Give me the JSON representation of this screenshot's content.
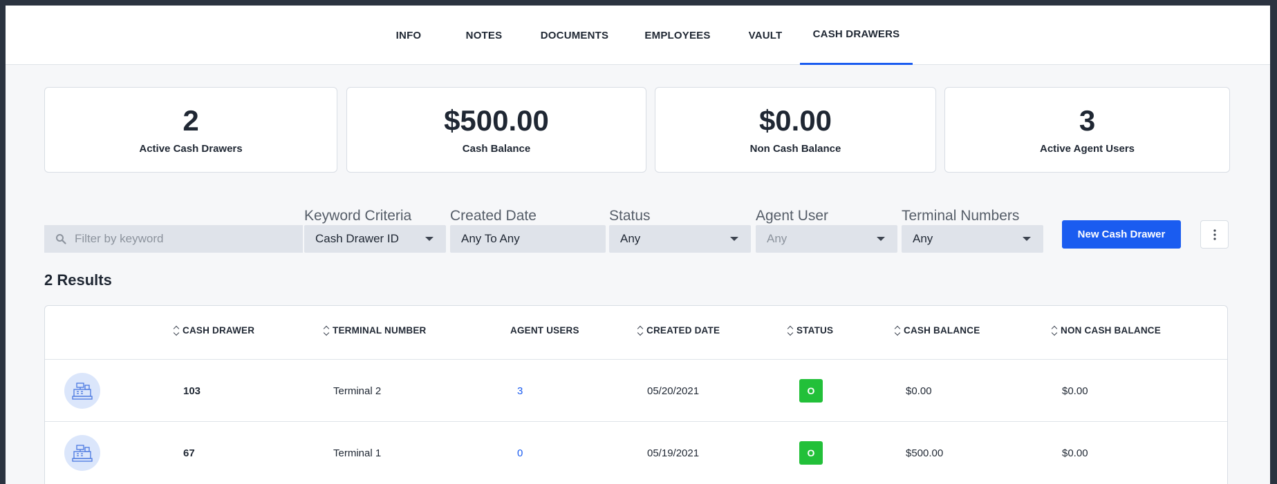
{
  "tabs": [
    "INFO",
    "NOTES",
    "DOCUMENTS",
    "EMPLOYEES",
    "VAULT",
    "CASH DRAWERS"
  ],
  "active_tab": "CASH DRAWERS",
  "stats": [
    {
      "value": "2",
      "label": "Active Cash Drawers"
    },
    {
      "value": "$500.00",
      "label": "Cash Balance"
    },
    {
      "value": "$0.00",
      "label": "Non Cash Balance"
    },
    {
      "value": "3",
      "label": "Active Agent Users"
    }
  ],
  "filters": {
    "search_placeholder": "Filter by keyword",
    "keyword_criteria": {
      "label": "Keyword Criteria",
      "value": "Cash Drawer ID"
    },
    "created_date": {
      "label": "Created Date",
      "value": "Any To Any"
    },
    "status": {
      "label": "Status",
      "value": "Any"
    },
    "agent_user": {
      "label": "Agent User",
      "value": "Any"
    },
    "terminal_numbers": {
      "label": "Terminal Numbers",
      "value": "Any"
    }
  },
  "new_button": "New Cash Drawer",
  "results_label": "2 Results",
  "table": {
    "headers": [
      "CASH DRAWER",
      "TERMINAL NUMBER",
      "AGENT USERS",
      "CREATED DATE",
      "STATUS",
      "CASH BALANCE",
      "NON CASH BALANCE"
    ],
    "rows": [
      {
        "drawer": "103",
        "terminal": "Terminal 2",
        "agent_users": "3",
        "created": "05/20/2021",
        "status": "O",
        "cash": "$0.00",
        "non_cash": "$0.00"
      },
      {
        "drawer": "67",
        "terminal": "Terminal 1",
        "agent_users": "0",
        "created": "05/19/2021",
        "status": "O",
        "cash": "$500.00",
        "non_cash": "$0.00"
      }
    ]
  },
  "colors": {
    "accent": "#1a5cf0",
    "status_open": "#22c039",
    "top_bar": "#2b3340"
  }
}
